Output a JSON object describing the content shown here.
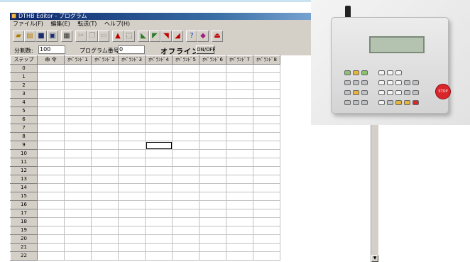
{
  "window": {
    "title": "DTHB Editor - プログラム"
  },
  "menu": [
    "ファイル(F)",
    "編集(E)",
    "転送(T)",
    "ヘルプ(H)"
  ],
  "toolbar": {
    "buttons": [
      "open-icon",
      "new-icon",
      "save-icon",
      "save-as-icon",
      "print-icon",
      "cut-icon",
      "copy-icon",
      "paste-icon",
      "insert-row-icon",
      "select-icon",
      "read-icon",
      "write-icon",
      "verify-icon",
      "compare-icon",
      "help-icon",
      "about-icon",
      "exit-icon"
    ]
  },
  "settings": {
    "resolution_label": "分割数:",
    "resolution_value": "100",
    "program_label": "プログラム番号",
    "program_value": "0",
    "mode_status": "オフライン",
    "toggle_label": "ON/OFF"
  },
  "grid": {
    "columns": [
      "ステップ",
      "命 令",
      "ｵﾍﾟﾗﾝﾄﾞ1",
      "ｵﾍﾟﾗﾝﾄﾞ2",
      "ｵﾍﾟﾗﾝﾄﾞ3",
      "ｵﾍﾟﾗﾝﾄﾞ4",
      "ｵﾍﾟﾗﾝﾄﾞ5",
      "ｵﾍﾟﾗﾝﾄﾞ6",
      "ｵﾍﾟﾗﾝﾄﾞ7",
      "ｵﾍﾟﾗﾝﾄﾞ8"
    ],
    "rows": [
      "0",
      "1",
      "2",
      "3",
      "4",
      "5",
      "6",
      "7",
      "8",
      "9",
      "10",
      "11",
      "12",
      "13",
      "14",
      "15",
      "16",
      "17",
      "18",
      "19",
      "20",
      "21",
      "22"
    ],
    "selected": {
      "row": 9,
      "column": "ｵﾍﾟﾗﾝﾄﾞ4"
    }
  },
  "photo": {
    "stop_label": "STOP",
    "colors": {
      "green": "#8cc36e",
      "yellow": "#e6b63c",
      "red": "#d8262b"
    }
  }
}
